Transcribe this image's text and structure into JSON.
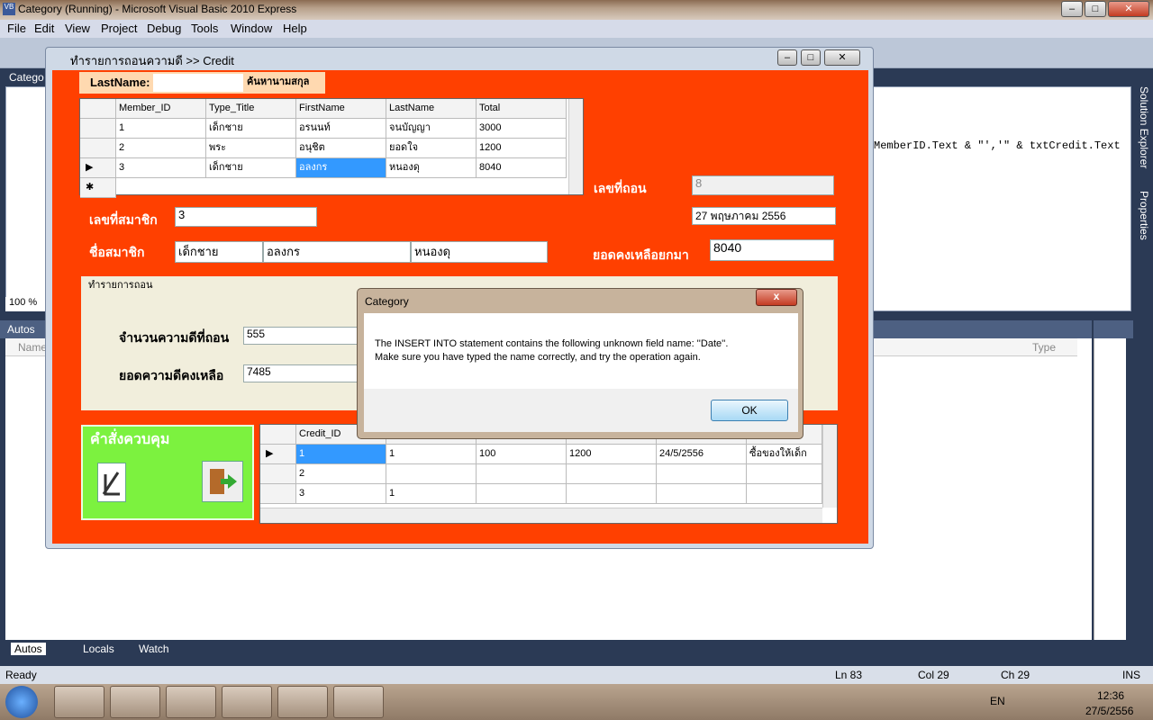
{
  "ide": {
    "title": "Category (Running) - Microsoft Visual Basic 2010 Express",
    "menu": [
      "File",
      "Edit",
      "View",
      "Project",
      "Debug",
      "Tools",
      "Window",
      "Help"
    ],
    "tab_partial": "Catego",
    "zoom": "100 %",
    "code_line": "MemberID.Text & \"','\" & txtCredit.Text",
    "solution_explorer": "Solution Explorer",
    "properties": "Properties",
    "autos_title": "Autos",
    "autos_col_name": "Name",
    "autos_col_type": "Type",
    "bottom_tabs": [
      "Autos",
      "Locals",
      "Watch"
    ],
    "status": {
      "left": "Ready",
      "ln": "Ln 83",
      "col": "Col 29",
      "ch": "Ch 29",
      "ins": "INS"
    }
  },
  "taskbar": {
    "lang": "EN",
    "time": "12:36",
    "date": "27/5/2556"
  },
  "form": {
    "title": "ทำรายการถอนความดี  >> Credit",
    "lastname_label": "LastName:",
    "search_button": "ค้นหานามสกุล",
    "grid1": {
      "headers": [
        "Member_ID",
        "Type_Title",
        "FirstName",
        "LastName",
        "Total"
      ],
      "rows": [
        [
          "1",
          "เด็กชาย",
          "อรนนท์",
          "จนบัญญา",
          "3000"
        ],
        [
          "2",
          "พระ",
          "อนุชิต",
          "ยอดใจ",
          "1200"
        ],
        [
          "3",
          "เด็กชาย",
          "อลงกร",
          "หนองดุ",
          "8040"
        ]
      ]
    },
    "withdraw_no_label": "เลขที่ถอน",
    "withdraw_no": "8",
    "date": "27  พฤษภาคม   2556",
    "member_no_label": "เลขที่สมาชิก",
    "member_no": "3",
    "member_name_label": "ชื่อสมาชิก",
    "name_title": "เด็กชาย",
    "name_first": "อลงกร",
    "name_last": "หนองดุ",
    "balance_label": "ยอดคงเหลือยกมา",
    "balance": "8040",
    "group_label": "ทำรายการถอน",
    "amount_label": "จำนวนความดีที่ถอน",
    "amount": "555",
    "remain_label": "ยอดความดีคงเหลือ",
    "remain": "7485",
    "control_label": "คำสั่งควบคุม",
    "grid2": {
      "header": "Credit_ID",
      "rows": [
        [
          "1",
          "1",
          "100",
          "1200",
          "24/5/2556",
          "ซื้อของให้เด็ก"
        ],
        [
          "2",
          "",
          "",
          "",
          "",
          ""
        ],
        [
          "3",
          "1",
          "",
          "",
          "",
          ""
        ]
      ]
    }
  },
  "dialog": {
    "title": "Category",
    "line1": "The INSERT INTO statement contains the following unknown field name: ''Date''.",
    "line2": "Make sure you have typed the name correctly, and try the operation again.",
    "ok": "OK",
    "close": "x"
  }
}
